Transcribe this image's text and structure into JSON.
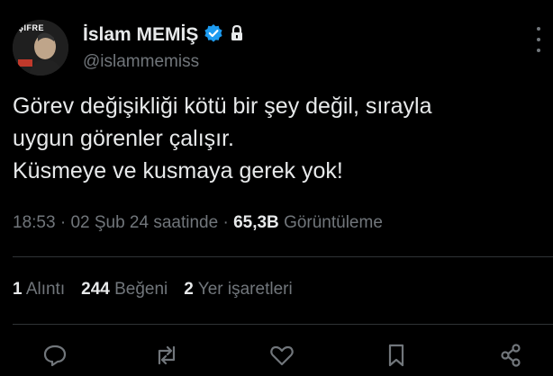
{
  "author": {
    "display_name": "İslam MEMİŞ",
    "handle": "@islammemiss",
    "avatar_brand": "ŞİFRE",
    "verified_color": "#1d9bf0"
  },
  "tweet": {
    "lines": [
      "Görev değişikliği kötü bir şey değil, sırayla",
      "uygun görenler çalışır.",
      "Küsmeye ve kusmaya gerek yok!"
    ]
  },
  "meta": {
    "time": "18:53",
    "date": "02 Şub 24 saatinde",
    "separator": "·",
    "views_count": "65,3B",
    "views_label": "Görüntüleme"
  },
  "stats": {
    "quotes_count": "1",
    "quotes_label": "Alıntı",
    "likes_count": "244",
    "likes_label": "Beğeni",
    "bookmarks_count": "2",
    "bookmarks_label": "Yer işaretleri"
  },
  "actions": [
    "reply-icon",
    "retweet-icon",
    "like-icon",
    "bookmark-icon",
    "share-icon"
  ]
}
